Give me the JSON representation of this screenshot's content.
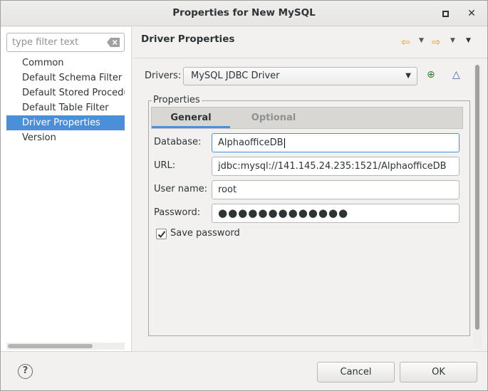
{
  "window": {
    "title": "Properties for New MySQL"
  },
  "sidebar": {
    "filter_placeholder": "type filter text",
    "items": [
      {
        "label": "Common"
      },
      {
        "label": "Default Schema Filter"
      },
      {
        "label": "Default Stored Procedu"
      },
      {
        "label": "Default Table Filter"
      },
      {
        "label": "Driver Properties",
        "selected": true
      },
      {
        "label": "Version"
      }
    ]
  },
  "page": {
    "title": "Driver Properties",
    "drivers_label": "Drivers:",
    "driver_selected": "MySQL JDBC Driver",
    "group_label": "Properties",
    "tabs": [
      {
        "label": "General",
        "active": true
      },
      {
        "label": "Optional",
        "active": false
      }
    ],
    "fields": {
      "database": {
        "label": "Database:",
        "value": "AlphaofficeDB"
      },
      "url": {
        "label": "URL:",
        "value": "jdbc:mysql://141.145.24.235:1521/AlphaofficeDB"
      },
      "username": {
        "label": "User name:",
        "value": "root"
      },
      "password": {
        "label": "Password:",
        "value": "●●●●●●●●●●●●●"
      }
    },
    "save_password": {
      "label": "Save password",
      "checked": true
    }
  },
  "footer": {
    "help_glyph": "?",
    "cancel_label": "Cancel",
    "ok_label": "OK"
  },
  "colors": {
    "selection": "#4a90d9",
    "nav_arrow": "#e0a020"
  }
}
